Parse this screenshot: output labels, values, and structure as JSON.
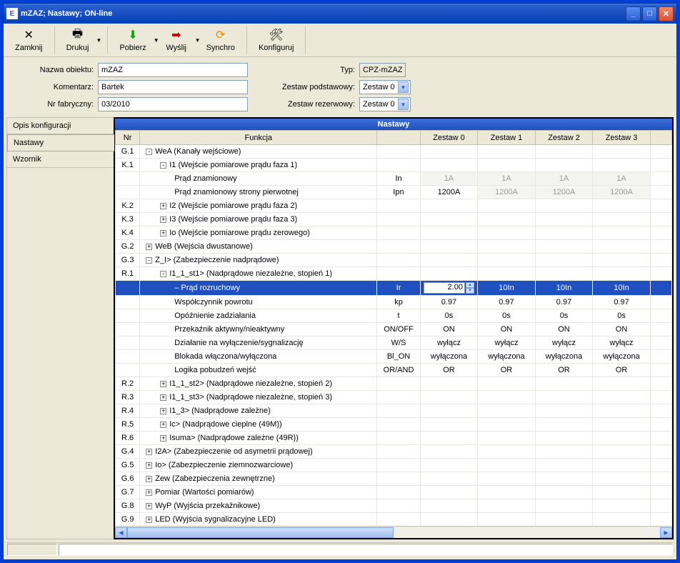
{
  "title": "mZAZ; Nastawy; ON-line",
  "titlebar_icon": "E",
  "toolbar": {
    "close": "Zamknij",
    "print": "Drukuj",
    "download": "Pobierz",
    "send": "Wyślij",
    "sync": "Synchro",
    "config": "Konfiguruj"
  },
  "form": {
    "obj_label": "Nazwa obiektu:",
    "obj_value": "mZAZ",
    "comment_label": "Komentarz:",
    "comment_value": "Bartek",
    "serial_label": "Nr fabryczny:",
    "serial_value": "03/2010",
    "type_label": "Typ:",
    "type_value": "CPZ-mZAZ",
    "set_main_label": "Zestaw podstawowy:",
    "set_main_value": "Zestaw 0",
    "set_res_label": "Zestaw rezerwowy:",
    "set_res_value": "Zestaw 0"
  },
  "sidebar": {
    "items": [
      "Opis konfiguracji",
      "Nastawy",
      "Wzornik"
    ],
    "active": 1
  },
  "panel_title": "Nastawy",
  "columns": {
    "nr": "Nr",
    "func": "Funkcja",
    "z0": "Zestaw 0",
    "z1": "Zestaw 1",
    "z2": "Zestaw 2",
    "z3": "Zestaw 3"
  },
  "rows": [
    {
      "nr": "G.1",
      "indent": 0,
      "box": "-",
      "label": "WeA (Kanały wejściowe)"
    },
    {
      "nr": "K.1",
      "indent": 1,
      "box": "-",
      "label": "I1 (Wejście pomiarowe prądu faza 1)"
    },
    {
      "nr": "",
      "indent": 2,
      "label": "Prąd znamionowy",
      "sym": "In",
      "z0": "1A",
      "z1": "1A",
      "z2": "1A",
      "z3": "1A",
      "dim": true
    },
    {
      "nr": "",
      "indent": 2,
      "label": "Prąd znamionowy strony pierwotnej",
      "sym": "Ipn",
      "z0": "1200A",
      "z1": "1200A",
      "z2": "1200A",
      "z3": "1200A",
      "dimrest": true
    },
    {
      "nr": "K.2",
      "indent": 1,
      "box": "+",
      "label": "I2 (Wejście pomiarowe prądu faza 2)"
    },
    {
      "nr": "K.3",
      "indent": 1,
      "box": "+",
      "label": "I3 (Wejście pomiarowe prądu faza 3)"
    },
    {
      "nr": "K.4",
      "indent": 1,
      "box": "+",
      "label": "Io (Wejście pomiarowe prądu zerowego)"
    },
    {
      "nr": "G.2",
      "indent": 0,
      "box": "+",
      "label": "WeB (Wejścia dwustanowe)"
    },
    {
      "nr": "G.3",
      "indent": 0,
      "box": "-",
      "label": "Z_I> (Zabezpieczenie nadprądowe)"
    },
    {
      "nr": "R.1",
      "indent": 1,
      "box": "-",
      "label": "I1_1_st1> (Nadprądowe niezależne, stopień 1)"
    },
    {
      "nr": "",
      "indent": 2,
      "bullet": true,
      "label": "Prąd rozruchowy",
      "sym": "Ir",
      "z0": "2.00",
      "z1": "10In",
      "z2": "10In",
      "z3": "10In",
      "selected": true,
      "edit": true
    },
    {
      "nr": "",
      "indent": 2,
      "label": "Współczynnik powrotu",
      "sym": "kp",
      "z0": "0.97",
      "z1": "0.97",
      "z2": "0.97",
      "z3": "0.97"
    },
    {
      "nr": "",
      "indent": 2,
      "label": "Opóźnienie zadziałania",
      "sym": "t",
      "z0": "0s",
      "z1": "0s",
      "z2": "0s",
      "z3": "0s"
    },
    {
      "nr": "",
      "indent": 2,
      "label": "Przekaźnik aktywny/nieaktywny",
      "sym": "ON/OFF",
      "z0": "ON",
      "z1": "ON",
      "z2": "ON",
      "z3": "ON"
    },
    {
      "nr": "",
      "indent": 2,
      "label": "Działanie na wyłączenie/sygnalizację",
      "sym": "W/S",
      "z0": "wyłącz",
      "z1": "wyłącz",
      "z2": "wyłącz",
      "z3": "wyłącz"
    },
    {
      "nr": "",
      "indent": 2,
      "label": "Blokada włączona/wyłączona",
      "sym": "Bl_ON",
      "z0": "wyłączona",
      "z1": "wyłączona",
      "z2": "wyłączona",
      "z3": "wyłączona"
    },
    {
      "nr": "",
      "indent": 2,
      "label": "Logika pobudzeń wejść",
      "sym": "OR/AND",
      "z0": "OR",
      "z1": "OR",
      "z2": "OR",
      "z3": "OR"
    },
    {
      "nr": "R.2",
      "indent": 1,
      "box": "+",
      "label": "I1_1_st2> (Nadprądowe niezależne, stopień 2)"
    },
    {
      "nr": "R.3",
      "indent": 1,
      "box": "+",
      "label": "I1_1_st3> (Nadprądowe niezależne, stopień 3)"
    },
    {
      "nr": "R.4",
      "indent": 1,
      "box": "+",
      "label": "I1_3> (Nadprądowe zależne)"
    },
    {
      "nr": "R.5",
      "indent": 1,
      "box": "+",
      "label": "Ic> (Nadprądowe cieplne (49M))"
    },
    {
      "nr": "R.6",
      "indent": 1,
      "box": "+",
      "label": "Isuma> (Nadprądowe zależne (49R))"
    },
    {
      "nr": "G.4",
      "indent": 0,
      "box": "+",
      "label": "I2A> (Zabezpieczenie od asymetrii prądowej)"
    },
    {
      "nr": "G.5",
      "indent": 0,
      "box": "+",
      "label": "Io> (Zabezpieczenie ziemnozwarciowe)"
    },
    {
      "nr": "G.6",
      "indent": 0,
      "box": "+",
      "label": "Zew (Zabezpieczenia zewnętrzne)"
    },
    {
      "nr": "G.7",
      "indent": 0,
      "box": "+",
      "label": "Pomiar (Wartości pomiarów)"
    },
    {
      "nr": "G.8",
      "indent": 0,
      "box": "+",
      "label": "WyP (Wyjścia przekaźnikowe)"
    },
    {
      "nr": "G.9",
      "indent": 0,
      "box": "+",
      "label": "LED (Wyjścia sygnalizacyjne LED)"
    }
  ]
}
